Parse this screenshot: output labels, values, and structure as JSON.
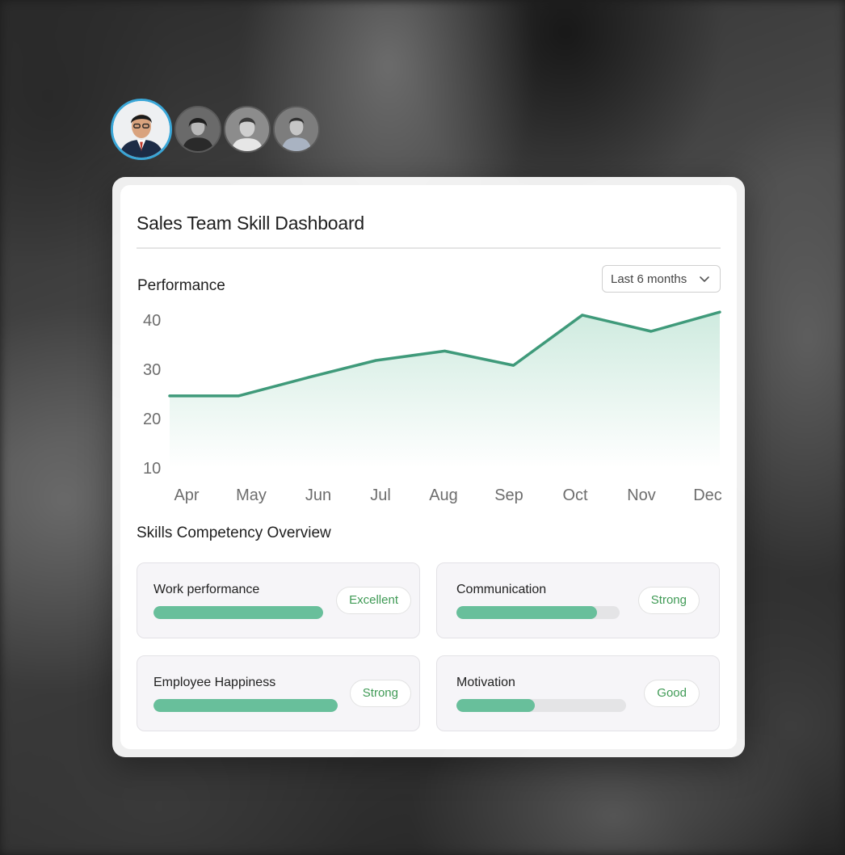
{
  "dashboard": {
    "title": "Sales Team Skill Dashboard",
    "performance_label": "Performance",
    "range_select": {
      "value": "Last 6 months"
    },
    "skills_title": "Skills Competency Overview",
    "skills": [
      {
        "name": "Work performance",
        "badge": "Excellent",
        "level": 1.0
      },
      {
        "name": "Communication",
        "badge": "Strong",
        "level": 0.86
      },
      {
        "name": "Employee Happiness",
        "badge": "Strong",
        "level": 1.0
      },
      {
        "name": "Motivation",
        "badge": "Good",
        "level": 0.46
      }
    ]
  },
  "team_avatars": [
    "avatar-selected",
    "avatar",
    "avatar",
    "avatar"
  ],
  "colors": {
    "line": "#3f9a7a",
    "fill": "#68bf9b",
    "badge_text": "#3f9a55",
    "avatar_ring": "#3aa7d8"
  },
  "chart_data": {
    "type": "area",
    "x": [
      "Apr",
      "May",
      "Jun",
      "Jul",
      "Aug",
      "Sep",
      "Oct",
      "Nov",
      "Dec"
    ],
    "series": [
      {
        "values": [
          24.6,
          24.6,
          28.3,
          31.8,
          33.7,
          30.8,
          41.0,
          37.7,
          41.6
        ]
      }
    ],
    "ylim": [
      10,
      40
    ],
    "y_ticks": [
      40,
      30,
      20,
      10
    ],
    "grid": false,
    "legend": "none"
  }
}
